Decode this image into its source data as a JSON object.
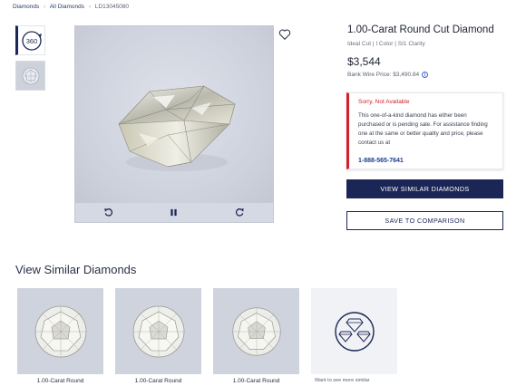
{
  "breadcrumb": {
    "items": [
      "Diamonds",
      "All Diamonds",
      "LD13045080"
    ],
    "separator": "›"
  },
  "media": {
    "thumbnails": [
      {
        "type": "360",
        "label": "360",
        "selected": true
      },
      {
        "type": "image",
        "selected": false
      }
    ],
    "controls": [
      "rotate-left-icon",
      "pause-icon",
      "rotate-right-icon"
    ]
  },
  "product": {
    "title": "1.00-Carat Round Cut Diamond",
    "specs": "Ideal Cut | I Color | SI1 Clarity",
    "price": "$3,544",
    "wire_price": "Bank Wire Price: $3,490.84",
    "info_icon": "i"
  },
  "alert": {
    "title": "Sorry, Not Available",
    "body": "This one-of-a-kind diamond has either been purchased or is pending sale. For assistance finding one at the same or better quality and price, please contact us at",
    "phone": "1-888-565-7641",
    "accent_color": "#d31f2a"
  },
  "actions": {
    "view_similar": "VIEW SIMILAR DIAMONDS",
    "compare": "SAVE TO COMPARISON"
  },
  "similar": {
    "title": "View Similar Diamonds",
    "cards": [
      {
        "label": "1.00-Carat Round"
      },
      {
        "label": "1.00-Carat Round"
      },
      {
        "label": "1.00-Carat Round"
      }
    ],
    "more_label": "Want to see more similar"
  },
  "colors": {
    "brand_navy": "#1b2656",
    "alert_red": "#d31f2a",
    "stage_gray": "#cfd3dd"
  }
}
